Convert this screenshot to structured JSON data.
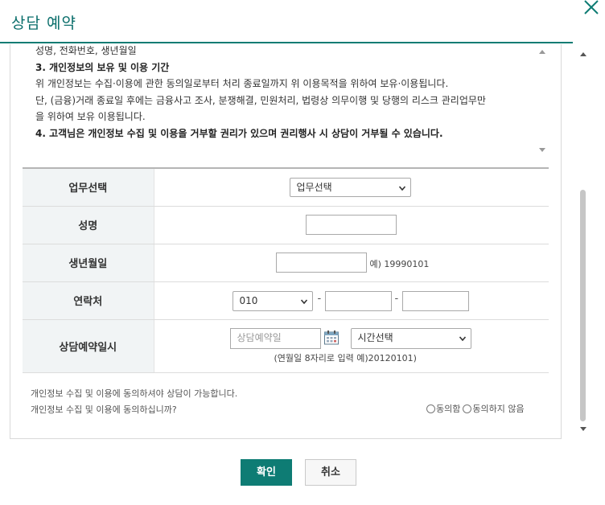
{
  "dialog": {
    "title": "상담 예약"
  },
  "terms": {
    "lines": [
      {
        "text": "성명, 전화번호, 생년월일",
        "bold": false
      },
      {
        "text": "3. 개인정보의 보유 및 이용 기간",
        "bold": true
      },
      {
        "text": "위 개인정보는 수집·이용에 관한 동의일로부터 처리 종료일까지 위 이용목적을 위하여 보유·이용됩니다.",
        "bold": false
      },
      {
        "text": "단, (금융)거래 종료일 후에는 금융사고 조사, 분쟁해결, 민원처리, 법령상 의무이행 및 당행의 리스크 관리업무만",
        "bold": false
      },
      {
        "text": "을 위하여 보유 이용됩니다.",
        "bold": false
      },
      {
        "text": "4. 고객님은 개인정보 수집 및 이용을 거부할 권리가 있으며 권리행사 시 상담이 거부될 수 있습니다.",
        "bold": true
      }
    ]
  },
  "form": {
    "business": {
      "label": "업무선택",
      "selected": "업무선택"
    },
    "name": {
      "label": "성명",
      "value": ""
    },
    "birth": {
      "label": "생년월일",
      "value": "",
      "hint": "예) 19990101"
    },
    "phone": {
      "label": "연락처",
      "prefix": "010",
      "dash": "-",
      "middle": "",
      "last": ""
    },
    "reservation": {
      "label": "상담예약일시",
      "date_placeholder": "상담예약일",
      "time_selected": "시간선택",
      "hint": "(연월일 8자리로 입력 예)20120101)"
    }
  },
  "consent": {
    "notice": "개인정보 수집 및 이용에 동의하셔야 상담이 가능합니다.",
    "question": "개인정보 수집 및 이용에 동의하십니까?",
    "agree": "동의함",
    "disagree": "동의하지 않음"
  },
  "buttons": {
    "confirm": "확인",
    "cancel": "취소"
  },
  "colors": {
    "accent": "#0e7c74",
    "header_bg": "#f1f4f5"
  },
  "icons": {
    "close": "close-icon",
    "calendar": "calendar-icon",
    "dropdown": "chevron-down-icon"
  }
}
